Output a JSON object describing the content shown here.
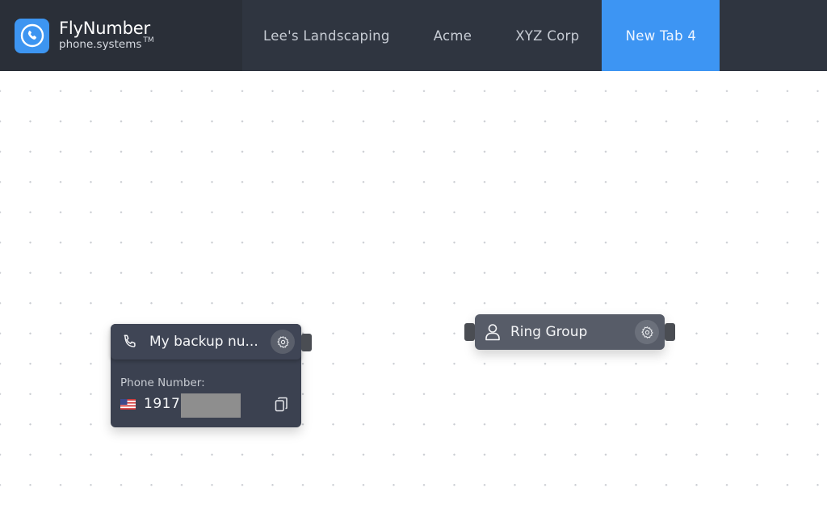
{
  "brand": {
    "name": "FlyNumber",
    "subtitle": "phone.systems",
    "trademark": "TM",
    "logo_icon": "phone-circle-icon",
    "logo_color": "#3d95f1"
  },
  "tabs": [
    {
      "label": "Lee's Landscaping",
      "active": false
    },
    {
      "label": "Acme",
      "active": false
    },
    {
      "label": "XYZ Corp",
      "active": false
    },
    {
      "label": "New Tab 4",
      "active": true
    }
  ],
  "colors": {
    "header_bg": "#2f3540",
    "brand_bg": "#2a2f38",
    "active_tab": "#3d95f3",
    "node_dark": "#3b4150",
    "node_gray": "#575c68"
  },
  "nodes": {
    "phone_number": {
      "icon": "phone-icon",
      "title": "My backup nu...",
      "field_label": "Phone Number:",
      "country_flag": "us-flag-icon",
      "number_visible": "19177",
      "number_redacted": true,
      "copy_icon": "copy-icon",
      "settings_icon": "gear-icon"
    },
    "ring_group": {
      "icon": "user-icon",
      "title": "Ring Group",
      "settings_icon": "gear-icon"
    }
  }
}
